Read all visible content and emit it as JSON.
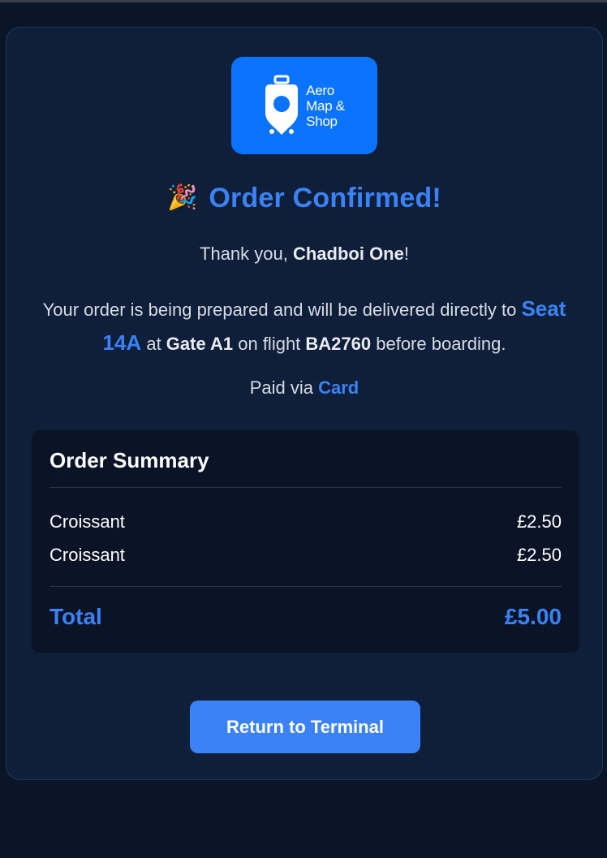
{
  "logo": {
    "line1": "Aero",
    "line2": "Map &",
    "line3": "Shop",
    "icon": "luggage-pin-icon",
    "bg_color": "#0a73ff"
  },
  "header": {
    "icon": "party-popper-icon",
    "icon_glyph": "🎉",
    "title": "Order Confirmed!"
  },
  "thanks": {
    "prefix": "Thank you, ",
    "name": "Chadboi One",
    "suffix": "!"
  },
  "description": {
    "part1": "Your order is being prepared and will be delivered directly to ",
    "seat": "Seat 14A",
    "part2": " at ",
    "gate": "Gate A1",
    "part3": " on flight ",
    "flight": "BA2760",
    "part4": " before boarding."
  },
  "payment": {
    "prefix": "Paid via ",
    "method": "Card"
  },
  "summary": {
    "title": "Order Summary",
    "items": [
      {
        "name": "Croissant",
        "price": "£2.50"
      },
      {
        "name": "Croissant",
        "price": "£2.50"
      }
    ],
    "total_label": "Total",
    "total_value": "£5.00"
  },
  "actions": {
    "return_label": "Return to Terminal"
  },
  "colors": {
    "accent": "#3b82f6",
    "background": "#0b1528",
    "card": "#0f1f3a"
  }
}
